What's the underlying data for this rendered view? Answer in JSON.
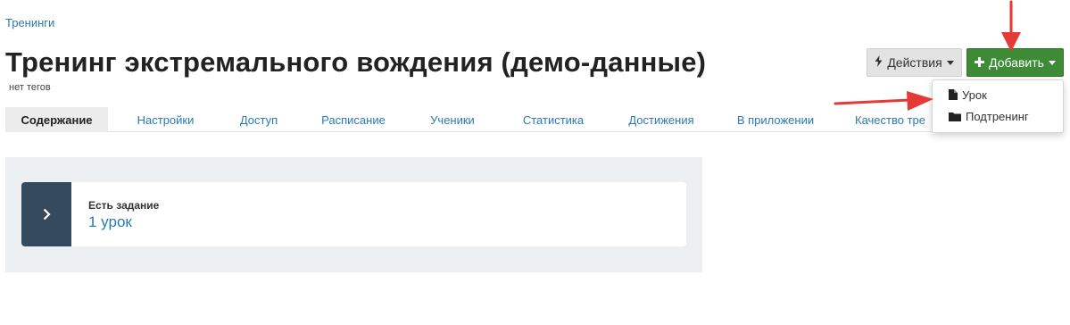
{
  "breadcrumb": {
    "label": "Тренинги"
  },
  "header": {
    "title": "Тренинг экстремального вождения (демо-данные)",
    "tags_label": "нет тегов"
  },
  "toolbar": {
    "actions_label": "Действия",
    "actions_icon": "lightning-icon",
    "add_label": "Добавить",
    "add_icon": "plus-icon"
  },
  "tabs": [
    {
      "label": "Содержание",
      "active": true
    },
    {
      "label": "Настройки"
    },
    {
      "label": "Доступ"
    },
    {
      "label": "Расписание"
    },
    {
      "label": "Ученики"
    },
    {
      "label": "Статистика"
    },
    {
      "label": "Достижения"
    },
    {
      "label": "В приложении"
    },
    {
      "label": "Качество тре"
    }
  ],
  "add_menu": {
    "items": [
      {
        "label": "Урок",
        "icon": "file-icon"
      },
      {
        "label": "Подтренинг",
        "icon": "folder-icon"
      }
    ]
  },
  "content": {
    "card_title": "Есть задание",
    "card_link": "1 урок",
    "toggle_icon": "chevron-right-icon"
  },
  "colors": {
    "link": "#2a7ab0",
    "add_button": "#3d8b36",
    "card_toggle": "#364a5e",
    "annotation_arrow": "#e53935"
  }
}
